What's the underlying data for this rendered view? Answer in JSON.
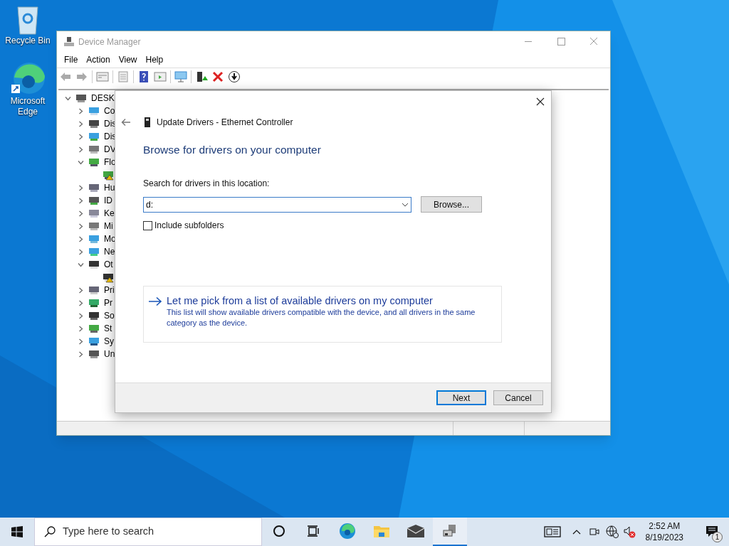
{
  "desktop_icons": [
    {
      "kind": "recycle",
      "label": "Recycle Bin"
    },
    {
      "kind": "edge",
      "label": "Microsoft Edge"
    }
  ],
  "device_manager": {
    "title": "Device Manager",
    "menu": [
      "File",
      "Action",
      "View",
      "Help"
    ],
    "tree": {
      "label": "DESK",
      "kind": "pc",
      "expanded": true,
      "children": [
        {
          "label": "Co",
          "kind": "computer",
          "expanded": false
        },
        {
          "label": "Dis",
          "kind": "drive",
          "expanded": false
        },
        {
          "label": "Dis",
          "kind": "display",
          "expanded": false
        },
        {
          "label": "DV",
          "kind": "disc",
          "expanded": false
        },
        {
          "label": "Flo",
          "kind": "floppy",
          "expanded": true,
          "children": [
            {
              "kind": "floppy",
              "warning": true
            }
          ]
        },
        {
          "label": "Hu",
          "kind": "hid",
          "expanded": false
        },
        {
          "label": "ID",
          "kind": "ide",
          "expanded": false
        },
        {
          "label": "Ke",
          "kind": "keyboard",
          "expanded": false
        },
        {
          "label": "Mi",
          "kind": "mouse",
          "expanded": false
        },
        {
          "label": "Mo",
          "kind": "monitor",
          "expanded": false
        },
        {
          "label": "Ne",
          "kind": "network",
          "expanded": false
        },
        {
          "label": "Ot",
          "kind": "other",
          "expanded": true,
          "children": [
            {
              "kind": "other",
              "warning": true
            }
          ]
        },
        {
          "label": "Pri",
          "kind": "printer",
          "expanded": false
        },
        {
          "label": "Pr",
          "kind": "processor",
          "expanded": false
        },
        {
          "label": "So",
          "kind": "software",
          "expanded": false
        },
        {
          "label": "St",
          "kind": "storage",
          "expanded": false
        },
        {
          "label": "Sy",
          "kind": "system",
          "expanded": false
        },
        {
          "label": "Un",
          "kind": "usb",
          "expanded": false
        }
      ]
    }
  },
  "dialog": {
    "title": "Update Drivers - Ethernet Controller",
    "heading": "Browse for drivers on your computer",
    "location_label": "Search for drivers in this location:",
    "location_value": "d:",
    "browse_button": "Browse...",
    "include_subfolders": {
      "label": "Include subfolders",
      "checked": false
    },
    "pick_option": {
      "title": "Let me pick from a list of available drivers on my computer",
      "description": "This list will show available drivers compatible with the device, and all drivers in the same category as the device."
    },
    "buttons": [
      {
        "label": "Next",
        "default": true
      },
      {
        "label": "Cancel",
        "default": false
      }
    ]
  },
  "taskbar": {
    "search_placeholder": "Type here to search",
    "apps": [
      {
        "kind": "cortana",
        "selected": false
      },
      {
        "kind": "taskview",
        "selected": false
      },
      {
        "kind": "edge",
        "selected": false
      },
      {
        "kind": "explorer",
        "selected": false
      },
      {
        "kind": "mail",
        "selected": false
      },
      {
        "kind": "devmgr",
        "selected": true
      }
    ],
    "time": "2:52 AM",
    "date": "8/19/2023",
    "notification_count": "1"
  }
}
